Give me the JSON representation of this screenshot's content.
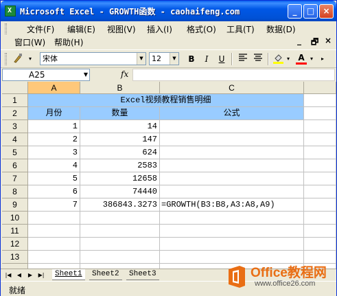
{
  "window": {
    "title": "Microsoft Excel - GROWTH函数 - caohaifeng.com",
    "app_icon": "excel-icon"
  },
  "menubar": {
    "items": [
      {
        "label": "文件(F)"
      },
      {
        "label": "编辑(E)"
      },
      {
        "label": "视图(V)"
      },
      {
        "label": "插入(I)"
      },
      {
        "label": "格式(O)"
      },
      {
        "label": "工具(T)"
      },
      {
        "label": "数据(D)"
      },
      {
        "label": "窗口(W)"
      },
      {
        "label": "帮助(H)"
      }
    ],
    "doc_controls": [
      "_",
      "🗗",
      "×"
    ]
  },
  "toolbar": {
    "font_name": "宋体",
    "font_size": "12",
    "bold": "B",
    "italic": "I",
    "underline": "U",
    "font_color_label": "A"
  },
  "formula_bar": {
    "name_box": "A25",
    "fx_label": "fx",
    "formula": ""
  },
  "grid": {
    "columns": [
      "A",
      "B",
      "C"
    ],
    "selected_column": "A",
    "rows": [
      "1",
      "2",
      "3",
      "4",
      "5",
      "6",
      "7",
      "8",
      "9",
      "10",
      "11",
      "12",
      "13"
    ],
    "title": "Excel视频教程销售明细",
    "headers": [
      "月份",
      "数量",
      "公式"
    ],
    "data": [
      {
        "month": "1",
        "qty": "14",
        "formula": ""
      },
      {
        "month": "2",
        "qty": "147",
        "formula": ""
      },
      {
        "month": "3",
        "qty": "624",
        "formula": ""
      },
      {
        "month": "4",
        "qty": "2583",
        "formula": ""
      },
      {
        "month": "5",
        "qty": "12658",
        "formula": ""
      },
      {
        "month": "6",
        "qty": "74440",
        "formula": ""
      },
      {
        "month": "7",
        "qty": "386843.3273",
        "formula": "=GROWTH(B3:B8,A3:A8,A9)"
      }
    ],
    "header_fill_color": "#99ccff"
  },
  "sheets": {
    "tabs": [
      "Sheet1",
      "Sheet2",
      "Sheet3"
    ],
    "active": "Sheet1"
  },
  "status": {
    "text": "就绪"
  },
  "watermark": {
    "brand": "Office教程网",
    "url": "www.office26.com",
    "brand_color": "#e96e14"
  }
}
